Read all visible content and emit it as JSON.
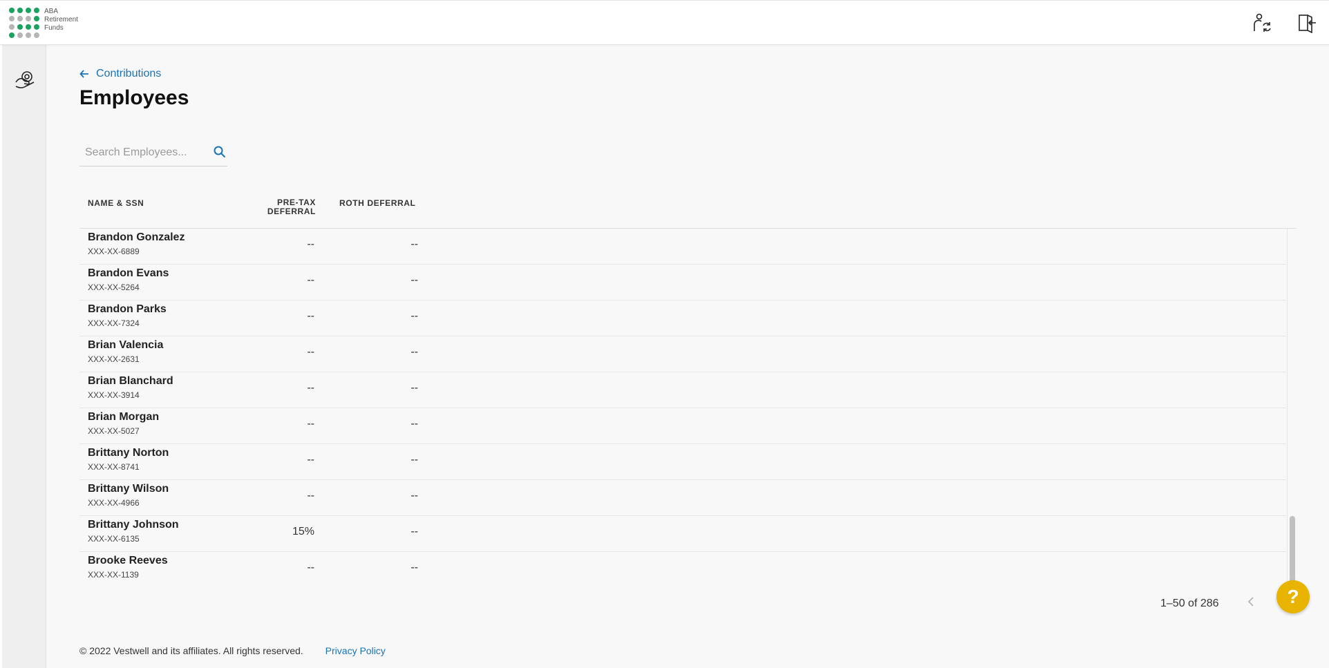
{
  "header": {
    "logo_lines": [
      "ABA",
      "Retirement",
      "Funds"
    ],
    "logo_dot_colors": [
      "#1aa260",
      "#1aa260",
      "#1aa260",
      "#1aa260",
      "#b5b5b5",
      "#b5b5b5",
      "#b5b5b5",
      "#1aa260",
      "#b5b5b5",
      "#1aa260",
      "#1aa260",
      "#1aa260",
      "#1aa260",
      "#b5b5b5",
      "#b5b5b5",
      "#b5b5b5"
    ],
    "icons": [
      "switch-user-icon",
      "logout-icon"
    ]
  },
  "sidebar": {
    "icons": [
      "hand-coin-icon"
    ]
  },
  "breadcrumb": {
    "back_label": "Contributions"
  },
  "page": {
    "title": "Employees"
  },
  "search": {
    "placeholder": "Search Employees..."
  },
  "table": {
    "columns": {
      "name": "NAME & SSN",
      "pretax": "PRE-TAX DEFERRAL",
      "roth": "ROTH DEFERRAL"
    },
    "pretax_header_lines": [
      "PRE-TAX",
      "DEFERRAL"
    ],
    "rows": [
      {
        "name": "Brandon Gonzalez",
        "ssn": "XXX-XX-6889",
        "pretax": "--",
        "roth": "--"
      },
      {
        "name": "Brandon Evans",
        "ssn": "XXX-XX-5264",
        "pretax": "--",
        "roth": "--"
      },
      {
        "name": "Brandon Parks",
        "ssn": "XXX-XX-7324",
        "pretax": "--",
        "roth": "--"
      },
      {
        "name": "Brian Valencia",
        "ssn": "XXX-XX-2631",
        "pretax": "--",
        "roth": "--"
      },
      {
        "name": "Brian Blanchard",
        "ssn": "XXX-XX-3914",
        "pretax": "--",
        "roth": "--"
      },
      {
        "name": "Brian Morgan",
        "ssn": "XXX-XX-5027",
        "pretax": "--",
        "roth": "--"
      },
      {
        "name": "Brittany Norton",
        "ssn": "XXX-XX-8741",
        "pretax": "--",
        "roth": "--"
      },
      {
        "name": "Brittany Wilson",
        "ssn": "XXX-XX-4966",
        "pretax": "--",
        "roth": "--"
      },
      {
        "name": "Brittany Johnson",
        "ssn": "XXX-XX-6135",
        "pretax": "15%",
        "roth": "--"
      },
      {
        "name": "Brooke Reeves",
        "ssn": "XXX-XX-1139",
        "pretax": "--",
        "roth": "--"
      }
    ]
  },
  "pagination": {
    "label": "1–50 of 286"
  },
  "help": {
    "label": "?"
  },
  "footer": {
    "copyright": "© 2022 Vestwell and its affiliates. All rights reserved.",
    "privacy": "Privacy Policy"
  },
  "colors": {
    "link": "#1a73b5",
    "help": "#e8b400",
    "brand_green": "#1aa260"
  }
}
